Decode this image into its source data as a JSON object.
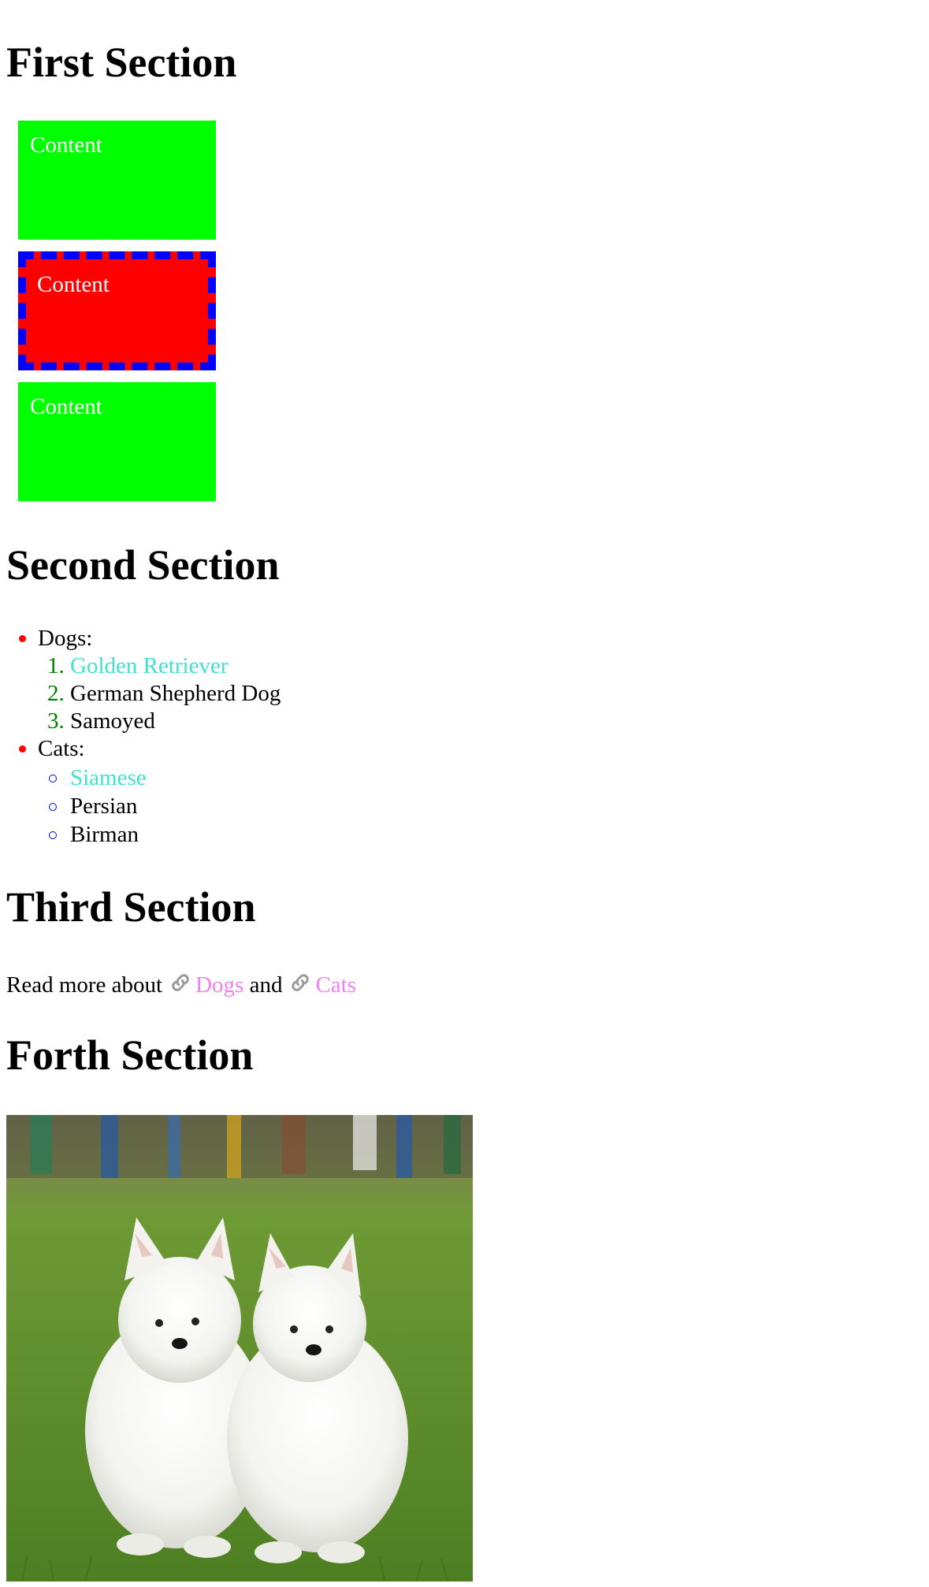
{
  "sections": [
    {
      "title": "First Section"
    },
    {
      "title": "Second Section"
    },
    {
      "title": "Third Section"
    },
    {
      "title": "Forth Section"
    }
  ],
  "boxes": [
    {
      "label": "Content",
      "style": "solid",
      "background": "#00ff00"
    },
    {
      "label": "Content",
      "style": "dashed",
      "background": "#ff0000",
      "border": "#0000ff"
    },
    {
      "label": "Content",
      "style": "solid",
      "background": "#00ff00"
    }
  ],
  "lists": {
    "dogs": {
      "label": "Dogs:",
      "items": [
        {
          "number": "1.",
          "text": "Golden Retriever",
          "highlight": true
        },
        {
          "number": "2.",
          "text": "German Shepherd Dog",
          "highlight": false
        },
        {
          "number": "3.",
          "text": "Samoyed",
          "highlight": false
        }
      ]
    },
    "cats": {
      "label": "Cats:",
      "items": [
        {
          "text": "Siamese",
          "highlight": true
        },
        {
          "text": "Persian",
          "highlight": false
        },
        {
          "text": "Birman",
          "highlight": false
        }
      ]
    }
  },
  "paragraph": {
    "prefix": "Read more about",
    "link_1": "Dogs",
    "conjunction": "and",
    "link_2": "Cats"
  },
  "image": {
    "icon": "photo-two-white-samoyed-puppies"
  },
  "colors": {
    "green_box": "#00ff00",
    "red_box": "#ff0000",
    "dashed_border": "#0000ff",
    "marker_red": "#ff0000",
    "number_green": "#008000",
    "highlight_cyan": "#40e0d0",
    "link_violet": "#ee82ee"
  }
}
